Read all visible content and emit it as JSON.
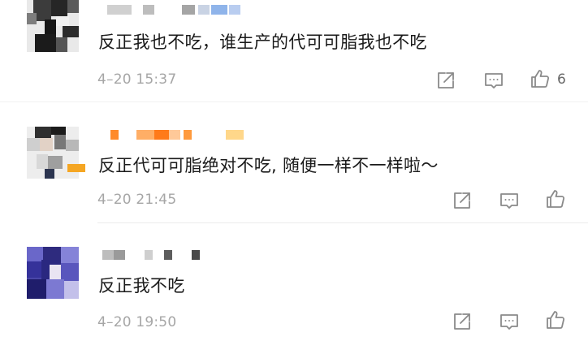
{
  "comments": [
    {
      "text": "反正我也不吃，谁生产的代可可脂我也不吃",
      "time": "4–20 15:37",
      "likes": "6",
      "avatar_icon": "pixelated-avatar-dark",
      "name_icon": "pixelated-username"
    },
    {
      "text": "反正代可可脂绝对不吃, 随便一样不一样啦～",
      "time": "4–20 21:45",
      "likes": "",
      "avatar_icon": "pixelated-avatar-gray",
      "name_icon": "pixelated-username-orange"
    },
    {
      "text": "反正我不吃",
      "time": "4–20 19:50",
      "likes": "",
      "avatar_icon": "pixelated-avatar-purple",
      "name_icon": "pixelated-username-gray"
    }
  ],
  "actions": {
    "share_icon": "share-icon",
    "reply_icon": "reply-icon",
    "like_icon": "thumbs-up-icon"
  },
  "colors": {
    "text": "#1a1a1a",
    "meta": "#a6a6a6",
    "icon": "#8a8a8a",
    "divider": "#ececec"
  }
}
